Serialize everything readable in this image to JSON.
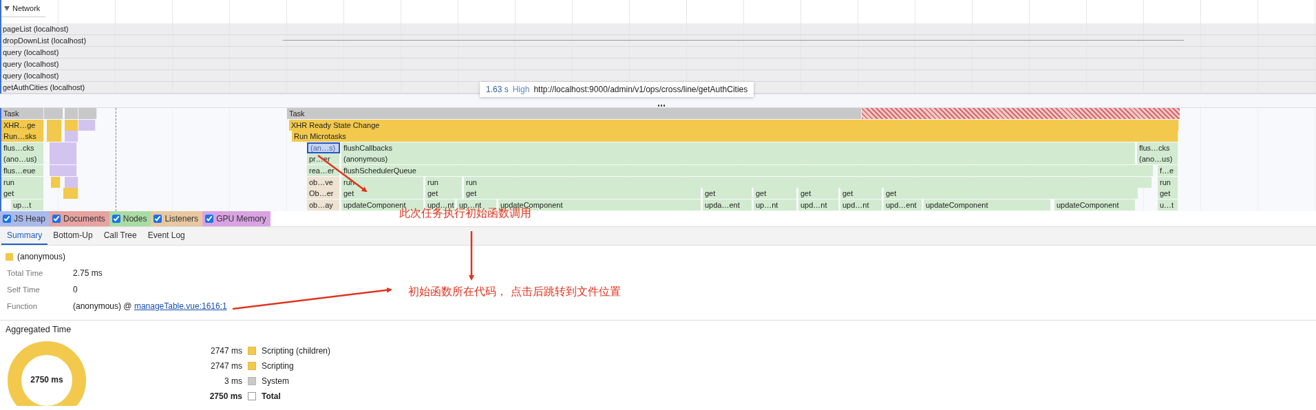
{
  "network": {
    "title": "Network",
    "expanded": true,
    "rows": [
      {
        "label": "pageList (localhost)",
        "timing_bar": false
      },
      {
        "label": "dropDownList (localhost)",
        "timing_bar": true
      },
      {
        "label": "query (localhost)",
        "timing_bar": false
      },
      {
        "label": "query (localhost)",
        "timing_bar": false
      },
      {
        "label": "query (localhost)",
        "timing_bar": false
      },
      {
        "label": "getAuthCities (localhost)",
        "timing_bar": false
      }
    ]
  },
  "tooltip": {
    "time": "1.63 s",
    "priority": "High",
    "url": "http://localhost:9000/admin/v1/ops/cross/line/getAuthCities"
  },
  "flame_chart": {
    "long_task_warning": true,
    "rows": [
      {
        "blocks": [
          {
            "label": "Task",
            "color": "#c8c8c8",
            "selected": false
          },
          {
            "color": "#c8c8c8",
            "selected": false
          },
          {
            "color": "#c8c8c8",
            "selected": false
          },
          {
            "color": "#c8c8c8",
            "selected": false
          },
          {
            "label": "Task",
            "color": "#c8c8c8",
            "selected": false
          }
        ]
      },
      {
        "blocks": [
          {
            "label": "XHR…ge",
            "color": "#f2c94c",
            "selected": false
          },
          {
            "color": "#f2c94c",
            "selected": false
          },
          {
            "color": "#f2c94c",
            "selected": false
          },
          {
            "color": "#d3c4ef",
            "selected": false
          },
          {
            "label": "XHR Ready State Change",
            "color": "#f2c94c",
            "selected": false
          }
        ]
      },
      {
        "blocks": [
          {
            "label": "Run…sks",
            "color": "#f2c94c",
            "selected": false
          },
          {
            "color": "#f2c94c",
            "selected": false
          },
          {
            "color": "#d3c4ef",
            "selected": false
          },
          {
            "label": "Run Microtasks",
            "color": "#f2c94c",
            "selected": false
          }
        ]
      },
      {
        "blocks": [
          {
            "label": "flus…cks",
            "color": "#d2ebd0",
            "selected": false
          },
          {
            "color": "#d3c4ef",
            "selected": false
          },
          {
            "label": "(an…s)",
            "color": "#c5d6f5",
            "selected": true
          },
          {
            "label": "flushCallbacks",
            "color": "#d2ebd0",
            "selected": false
          },
          {
            "label": "flus…cks",
            "color": "#d2ebd0",
            "selected": false
          }
        ]
      },
      {
        "blocks": [
          {
            "label": "(ano…us)",
            "color": "#d2ebd0",
            "selected": false
          },
          {
            "color": "#d3c4ef",
            "selected": false
          },
          {
            "label": "pr…er",
            "color": "#d2ebd0",
            "selected": false
          },
          {
            "label": "(anonymous)",
            "color": "#d2ebd0",
            "selected": false
          },
          {
            "label": "(ano…us)",
            "color": "#d2ebd0",
            "selected": false
          }
        ]
      },
      {
        "blocks": [
          {
            "label": "flus…eue",
            "color": "#d2ebd0",
            "selected": false
          },
          {
            "color": "#d3c4ef",
            "selected": false
          },
          {
            "label": "rea…er",
            "color": "#d2ebd0",
            "selected": false
          },
          {
            "label": "flushSchedulerQueue",
            "color": "#d2ebd0",
            "selected": false
          },
          {
            "label": "f…e",
            "color": "#d2ebd0",
            "selected": false
          }
        ]
      },
      {
        "blocks": [
          {
            "label": "run",
            "color": "#d2ebd0",
            "selected": false
          },
          {
            "color": "#f2c94c",
            "selected": false
          },
          {
            "color": "#d3c4ef",
            "selected": false
          },
          {
            "label": "ob…ve",
            "color": "#eee3d1",
            "selected": false
          },
          {
            "label": "run",
            "color": "#d2ebd0",
            "selected": false
          },
          {
            "label": "run",
            "color": "#d2ebd0",
            "selected": false
          },
          {
            "label": "run",
            "color": "#d2ebd0",
            "selected": false
          },
          {
            "label": "run",
            "color": "#d2ebd0",
            "selected": false
          }
        ]
      },
      {
        "blocks": [
          {
            "label": "get",
            "color": "#d2ebd0",
            "selected": false
          },
          {
            "color": "#f2c94c",
            "selected": false
          },
          {
            "label": "Ob…er",
            "color": "#eee3d1",
            "selected": false
          },
          {
            "label": "get",
            "color": "#d2ebd0",
            "selected": false
          },
          {
            "label": "get",
            "color": "#d2ebd0",
            "selected": false
          },
          {
            "label": "get",
            "color": "#d2ebd0",
            "selected": false
          },
          {
            "label": "get",
            "color": "#d2ebd0",
            "selected": false
          },
          {
            "label": "get",
            "color": "#d2ebd0",
            "selected": false
          },
          {
            "label": "get",
            "color": "#d2ebd0",
            "selected": false
          },
          {
            "label": "get",
            "color": "#d2ebd0",
            "selected": false
          },
          {
            "label": "get",
            "color": "#d2ebd0",
            "selected": false
          },
          {
            "label": "get",
            "color": "#d2ebd0",
            "selected": false
          }
        ]
      },
      {
        "blocks": [
          {
            "label": "up…t",
            "color": "#d2ebd0",
            "selected": false
          },
          {
            "label": "ob…ay",
            "color": "#eee3d1",
            "selected": false
          },
          {
            "label": "updateComponent",
            "color": "#d2ebd0",
            "selected": false
          },
          {
            "label": "upd…nt",
            "color": "#d2ebd0",
            "selected": false
          },
          {
            "label": "up…nt",
            "color": "#d2ebd0",
            "selected": false
          },
          {
            "label": "updateComponent",
            "color": "#d2ebd0",
            "selected": false
          },
          {
            "label": "upda…ent",
            "color": "#d2ebd0",
            "selected": false
          },
          {
            "label": "up…nt",
            "color": "#d2ebd0",
            "selected": false
          },
          {
            "label": "upd…nt",
            "color": "#d2ebd0",
            "selected": false
          },
          {
            "label": "upd…nt",
            "color": "#d2ebd0",
            "selected": false
          },
          {
            "label": "upd…ent",
            "color": "#d2ebd0",
            "selected": false
          },
          {
            "label": "updateComponent",
            "color": "#d2ebd0",
            "selected": false
          },
          {
            "label": "updateComponent",
            "color": "#d2ebd0",
            "selected": false
          },
          {
            "label": "u…t",
            "color": "#d2ebd0",
            "selected": false
          }
        ]
      }
    ]
  },
  "counters": [
    {
      "label": "JS Heap",
      "checked": true,
      "color": "#a9b9e9"
    },
    {
      "label": "Documents",
      "checked": true,
      "color": "#e6a3a0"
    },
    {
      "label": "Nodes",
      "checked": true,
      "color": "#a9dca3"
    },
    {
      "label": "Listeners",
      "checked": true,
      "color": "#e8c8a0"
    },
    {
      "label": "GPU Memory",
      "checked": true,
      "color": "#d9a3e3"
    }
  ],
  "tabs": [
    {
      "label": "Summary",
      "selected": true
    },
    {
      "label": "Bottom-Up",
      "selected": false
    },
    {
      "label": "Call Tree",
      "selected": false
    },
    {
      "label": "Event Log",
      "selected": false
    }
  ],
  "summary": {
    "title": "(anonymous)",
    "color": "#f2c94c",
    "fields": [
      {
        "label": "Total Time",
        "value": "2.75 ms"
      },
      {
        "label": "Self Time",
        "value": "0"
      }
    ],
    "function": {
      "label": "Function",
      "value": "(anonymous) @ ",
      "link": "manageTable.vue:1616:1"
    }
  },
  "aggregated": {
    "title": "Aggregated Time",
    "total": "2750 ms",
    "items": [
      {
        "value": "2747 ms",
        "label": "Scripting (children)",
        "color": "#f2c94c",
        "kind": "item"
      },
      {
        "value": "2747 ms",
        "label": "Scripting",
        "color": "#f2c94c",
        "kind": "item"
      },
      {
        "value": "3 ms",
        "label": "System",
        "color": "#c8c8c8",
        "kind": "item"
      },
      {
        "value": "2750 ms",
        "label": "Total",
        "color": "#ffffff",
        "kind": "total"
      }
    ]
  },
  "annotations": [
    {
      "text": "此次任务执行初始函数调用"
    },
    {
      "text": "初始函数所在代码， 点击后跳转到文件位置"
    }
  ]
}
